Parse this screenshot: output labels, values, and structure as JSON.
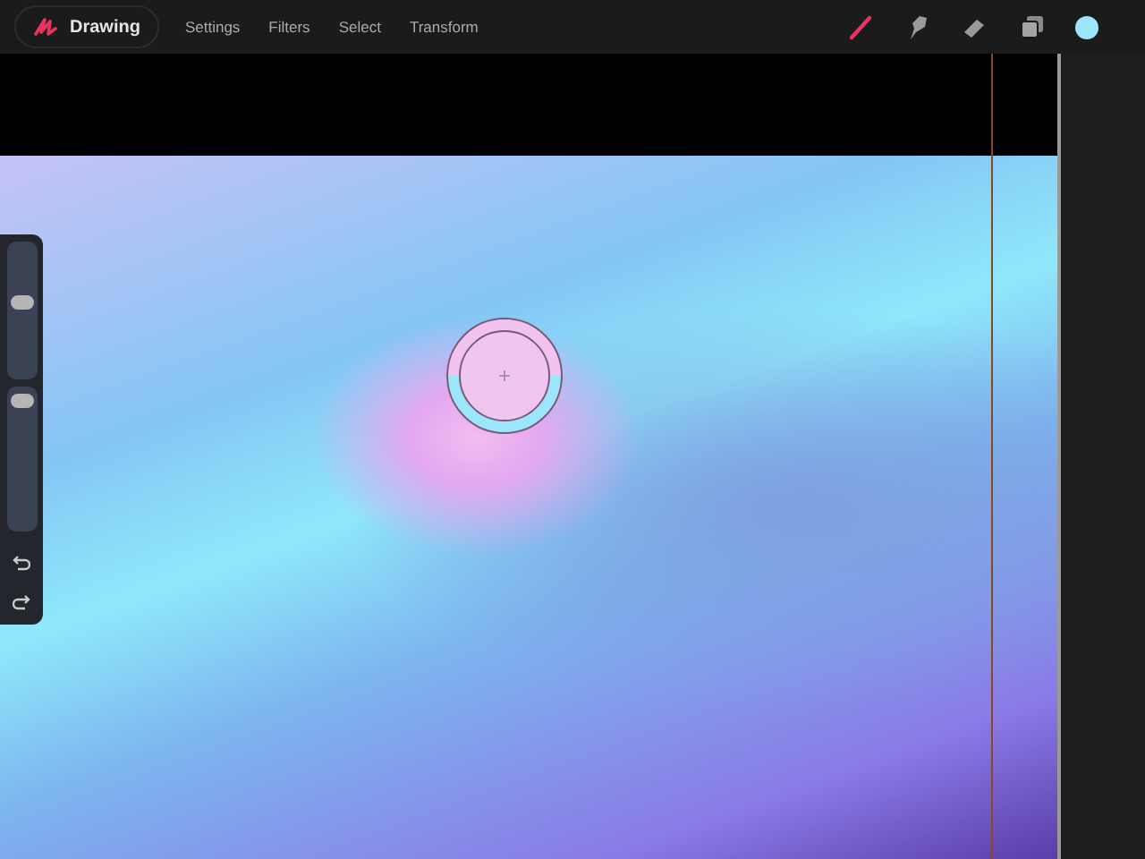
{
  "top_bar": {
    "gallery_button": "Drawing",
    "menu": [
      {
        "label": "Settings"
      },
      {
        "label": "Filters"
      },
      {
        "label": "Select"
      },
      {
        "label": "Transform"
      }
    ],
    "tools": [
      {
        "kind": "brush",
        "selected": true
      },
      {
        "kind": "smudge",
        "selected": false
      },
      {
        "kind": "eraser",
        "selected": false
      }
    ]
  },
  "sidebar": {
    "sliders": [
      {
        "kind": "size",
        "level": 0.57
      },
      {
        "kind": "opacity",
        "level": 0.91
      }
    ]
  }
}
